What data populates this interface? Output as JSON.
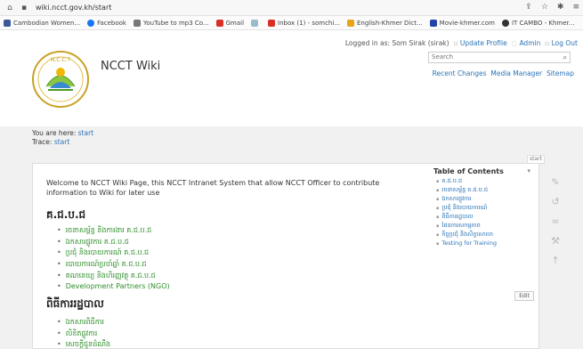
{
  "browser": {
    "url": "wiki.ncct.gov.kh/start",
    "bookmarks": [
      {
        "label": "Cambodian Women...",
        "color": "#3b5998"
      },
      {
        "label": "Facebook",
        "color": "#1877f2"
      },
      {
        "label": "YouTube to mp3 Co...",
        "color": "#777"
      },
      {
        "label": "Gmail",
        "color": "#d93025"
      },
      {
        "label": "",
        "color": "#9bc"
      },
      {
        "label": "Inbox (1) - somchi...",
        "color": "#d93025"
      },
      {
        "label": "English-Khmer Dict...",
        "color": "#e8a317"
      },
      {
        "label": "Movie-khmer.com",
        "color": "#2244aa"
      },
      {
        "label": "IT CAMBO - Khmer...",
        "color": "#333"
      }
    ]
  },
  "wiki": {
    "logged_in_text": "Logged in as: Som Sirak (sirak)",
    "user_links": [
      "Update Profile",
      "Admin",
      "Log Out"
    ],
    "site_title": "NCCT Wiki",
    "search_placeholder": "Search",
    "site_links": [
      "Recent Changes",
      "Media Manager",
      "Sitemap"
    ],
    "you_are_here_label": "You are here: ",
    "you_are_here_link": "start",
    "trace_label": "Trace: ",
    "trace_link": "start",
    "tab_label": "start",
    "intro": "Welcome to NCCT Wiki Page, this NCCT Intranet System that allow NCCT Officer to contribute information to Wiki for later use",
    "section1_title": "គ.ជ.ប.ជ",
    "section1_items": [
      "រចនាសម្ព័ន្ធ និងការងារ គ.ជ.ប.ជ",
      "ឯកសារផ្លូវការ គ.ជ.ប.ជ",
      "ប្រជុំ និងរបាយការណ៍ គ.ជ.ប.ជ",
      "របាយការណ៍ប្រចាំឆ្នាំ គ.ជ.ប.ជ",
      "គណនេយ្យ និងហិរញ្ញវត្ថុ គ.ជ.ប.ជ",
      "Development Partners (NGO)"
    ],
    "section2_title": "ពិធីការរដ្ឋបាល",
    "section2_items": [
      "ឯកសារពិធីការ",
      "លិខិតផ្លូវការ",
      "សេចក្ដីជូនដំណឹង"
    ],
    "toc_title": "Table of Contents",
    "toc_items": [
      "គ.ជ.ប.ជ",
      "រចនាសម្ព័ន្ធ គ.ជ.ប.ជ",
      "ឯកសារផ្លូវការ",
      "ប្រជុំ និងរបាយការណ៍",
      "ពិធីការរដ្ឋបាល",
      "ផែនការសកម្មភាព",
      "កិច្ចប្រជុំ និងសិក្ខាសាលា",
      "Testing for Training"
    ],
    "edit_label": "Edit"
  }
}
